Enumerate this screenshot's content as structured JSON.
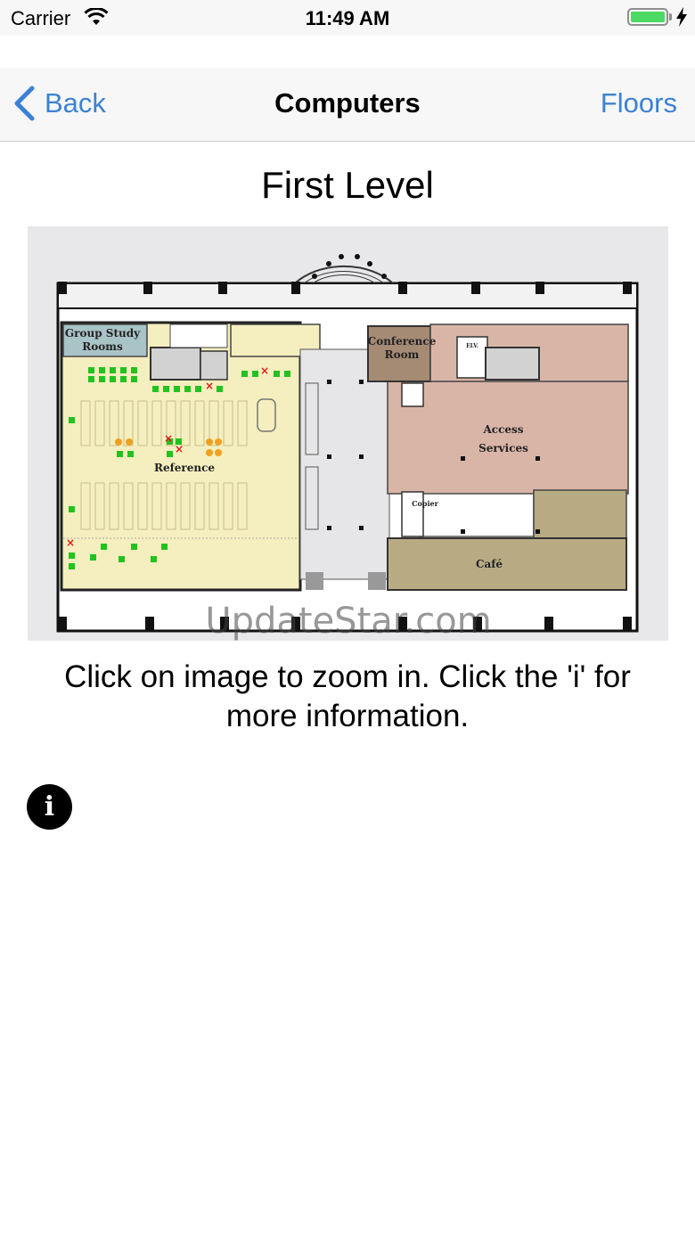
{
  "status_bar": {
    "carrier": "Carrier",
    "time": "11:49 AM"
  },
  "nav": {
    "back_label": "Back",
    "title": "Computers",
    "right_label": "Floors"
  },
  "page": {
    "level_title": "First Level",
    "hint": "Click on image to zoom in. Click the 'i' for more information.",
    "info_glyph": "i"
  },
  "floor_plan": {
    "rooms": {
      "group_study_1": "Group Study",
      "group_study_2": "Rooms",
      "reference": "Reference",
      "conference_1": "Conference",
      "conference_2": "Room",
      "access_1": "Access",
      "access_2": "Services",
      "cafe": "Café",
      "copier": "Copier",
      "elv": "ELV."
    },
    "watermark": "UpdateStar.com",
    "colors": {
      "available": "#22c21f",
      "in_use": "#e01b1b",
      "other": "#f0a020",
      "left_wing": "#f5eebe",
      "right_wing": "#d9b5a7",
      "cafe": "#b8ab84",
      "group_study": "#a9c4c6"
    }
  }
}
